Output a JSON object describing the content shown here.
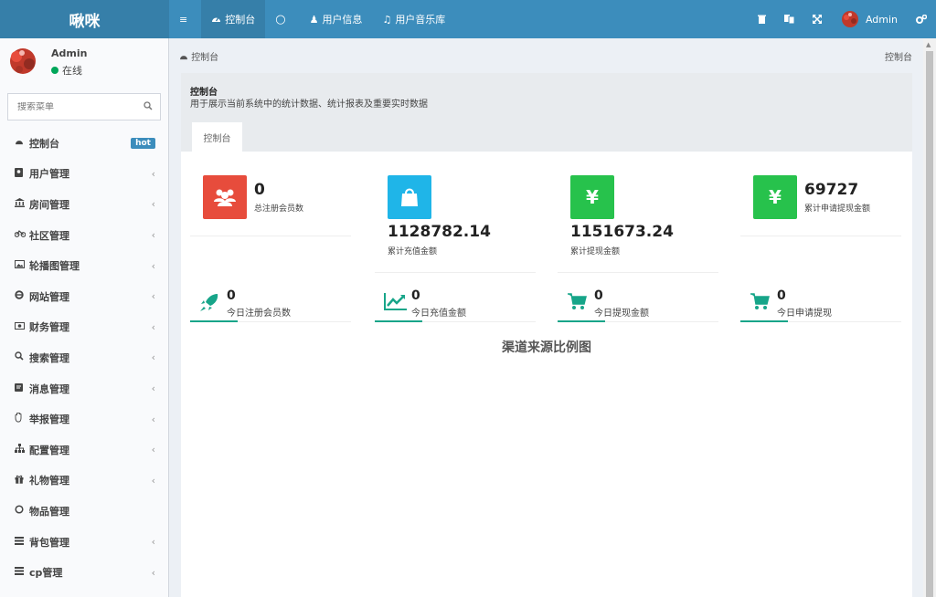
{
  "header": {
    "logo": "啾咪",
    "nav": [
      {
        "label": "",
        "icon": "≡"
      },
      {
        "label": "控制台",
        "icon": "⌚"
      },
      {
        "label": "",
        "icon": "○"
      },
      {
        "label": "用户信息",
        "icon": "♟"
      },
      {
        "label": "用户音乐库",
        "icon": "♫"
      }
    ],
    "admin_name": "Admin"
  },
  "sidebar": {
    "user_name": "Admin",
    "status": "在线",
    "search_placeholder": "搜索菜单",
    "items": [
      {
        "label": "控制台",
        "badge": "hot"
      },
      {
        "label": "用户管理"
      },
      {
        "label": "房间管理"
      },
      {
        "label": "社区管理"
      },
      {
        "label": "轮播图管理"
      },
      {
        "label": "网站管理"
      },
      {
        "label": "财务管理"
      },
      {
        "label": "搜索管理"
      },
      {
        "label": "消息管理"
      },
      {
        "label": "举报管理"
      },
      {
        "label": "配置管理"
      },
      {
        "label": "礼物管理"
      },
      {
        "label": "物品管理"
      },
      {
        "label": "背包管理"
      },
      {
        "label": "cp管理"
      }
    ]
  },
  "main": {
    "breadcrumb": "控制台",
    "breadcrumb_right": "控制台",
    "panel_title": "控制台",
    "panel_desc": "用于展示当前系统中的统计数据、统计报表及重要实时数据",
    "tab": "控制台",
    "stats": [
      {
        "value": "0",
        "label": "总注册会员数",
        "color": "#e74c3c",
        "icon": "users-icon"
      },
      {
        "value": "1128782.14",
        "label": "累计充值金额",
        "color": "#1fb5e8",
        "icon": "bag-icon"
      },
      {
        "value": "1151673.24",
        "label": "累计提现金额",
        "color": "#27c24c",
        "icon": "yen-icon"
      },
      {
        "value": "69727",
        "label": "累计申请提现金额",
        "color": "#27c24c",
        "icon": "yen-icon"
      }
    ],
    "mini_stats": [
      {
        "value": "0",
        "label": "今日注册会员数",
        "icon": "rocket-icon"
      },
      {
        "value": "0",
        "label": "今日充值金额",
        "icon": "chart-line-icon"
      },
      {
        "value": "0",
        "label": "今日提现金额",
        "icon": "cart-icon"
      },
      {
        "value": "0",
        "label": "今日申请提现",
        "icon": "cart-icon"
      }
    ],
    "chart_title": "渠道来源比例图"
  }
}
